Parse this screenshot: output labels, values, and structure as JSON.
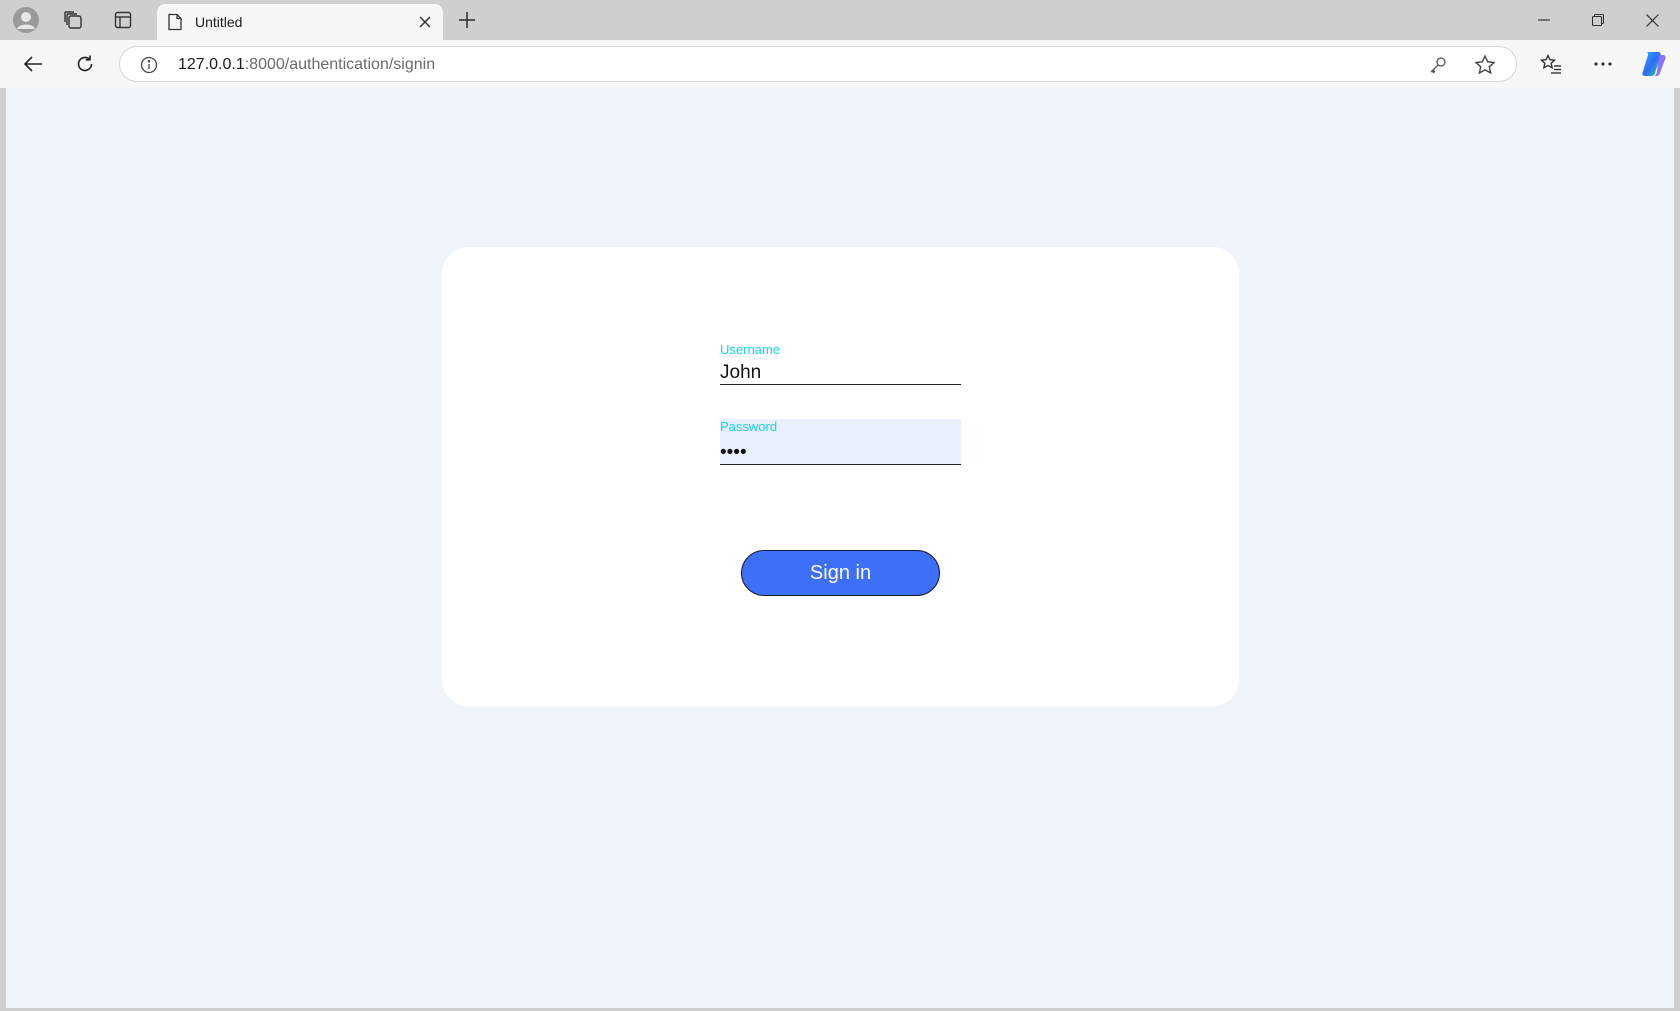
{
  "browser": {
    "tab": {
      "title": "Untitled"
    },
    "address": {
      "host": "127.0.0.1",
      "path": ":8000/authentication/signin"
    }
  },
  "page": {
    "username": {
      "label": "Username",
      "value": "John"
    },
    "password": {
      "label": "Password",
      "value": "••••"
    },
    "signin_label": "Sign in"
  },
  "colors": {
    "page_background": "#eff3fa",
    "card_background": "#ffffff",
    "label_accent": "#19d3e4",
    "button_primary": "#3d6ff8",
    "autofill_background": "#e8f0fe"
  }
}
